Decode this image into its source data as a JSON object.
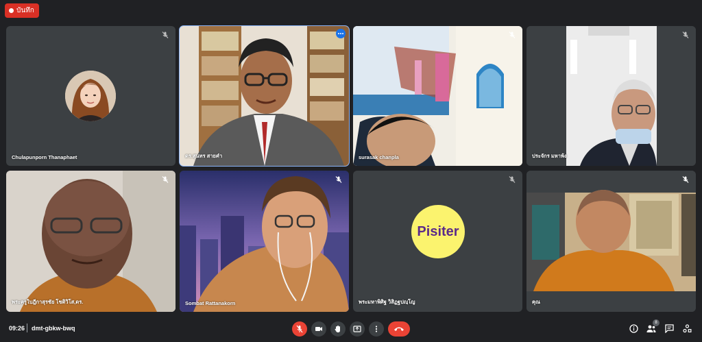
{
  "recording": {
    "label": "บันทึก",
    "color": "#d93025"
  },
  "participants": [
    {
      "name": "Chulapunporn Thanaphaet",
      "muted": true,
      "type": "avatar"
    },
    {
      "name": "ดร.สุนทร สายคำ",
      "muted": false,
      "type": "video",
      "active": true
    },
    {
      "name": "surasak chanpla",
      "muted": true,
      "type": "video"
    },
    {
      "name": "ประจักร มหาพ้ง",
      "muted": true,
      "type": "video"
    },
    {
      "name": "พระครูใบฎีกาสุรชัย โชติวิโส,ดร.",
      "muted": true,
      "type": "video"
    },
    {
      "name": "Sombat Rattanakorn",
      "muted": true,
      "type": "video"
    },
    {
      "name": "พระมหาพิศิฐ วิสิฏฐปญฺโญ",
      "muted": true,
      "type": "initials",
      "initials": "Pisiter"
    },
    {
      "name": "คุณ",
      "muted": true,
      "type": "video"
    }
  ],
  "meeting": {
    "time": "09:26",
    "code": "dmt-gbkw-bwq"
  },
  "controls": [
    "mic-off",
    "camera",
    "raise-hand",
    "present",
    "more",
    "hang-up"
  ],
  "people_count": "8",
  "colors": {
    "background": "#202124",
    "tile": "#3c4043",
    "accent": "#ea4335",
    "active_border": "#8ab4f8",
    "initials_bg": "#fbf36e"
  }
}
